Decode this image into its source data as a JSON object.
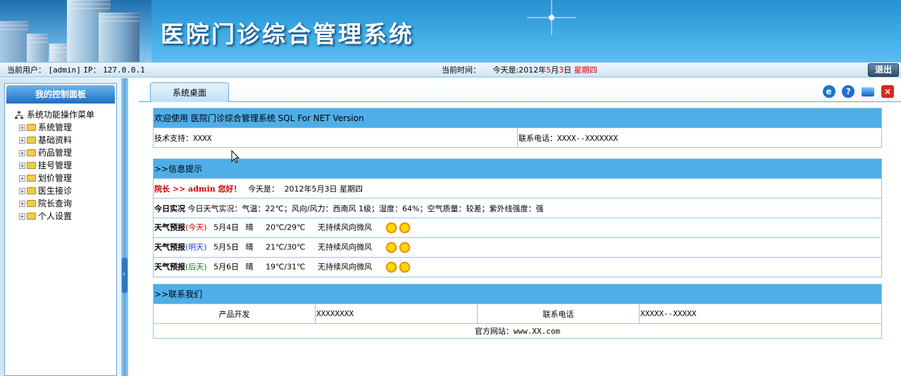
{
  "header": {
    "title": "医院门诊综合管理系统"
  },
  "status": {
    "user_label": "当前用户：",
    "user_value": "[admin]",
    "ip_label": "IP：",
    "ip_value": "127.0.0.1",
    "time_label": "当前时间：",
    "today_prefix": "今天是:2012年",
    "month": "5",
    "month_suffix": "月",
    "day": "3",
    "day_suffix": "日",
    "weekday": "星期四",
    "logout_label": "退出"
  },
  "sidebar": {
    "heading": "我的控制面板",
    "root": "系统功能操作菜单",
    "items": [
      {
        "label": "系统管理"
      },
      {
        "label": "基础资料"
      },
      {
        "label": "药品管理"
      },
      {
        "label": "挂号管理"
      },
      {
        "label": "划价管理"
      },
      {
        "label": "医生接诊"
      },
      {
        "label": "院长查询"
      },
      {
        "label": "个人设置"
      }
    ]
  },
  "tabs": {
    "active": "系统桌面"
  },
  "welcome_box": {
    "title": "欢迎使用 医院门诊综合管理系统 SQL For NET Version",
    "support_label": "技术支持：",
    "support_value": "XXXX",
    "phone_label": "联系电话：",
    "phone_value": "XXXX--XXXXXXX"
  },
  "info_box": {
    "title": ">>信息提示",
    "greeting": "院长 >> admin 您好！",
    "today_label": "今天是：",
    "today_value": "2012年5月3日 星期四",
    "realtime_label": "今日实况",
    "realtime_value": "今日天气实况：气温：22℃；风向/风力：西南风 1级；湿度：64%；空气质量：较差；紫外线强度：强",
    "forecast_label": "天气预报",
    "forecasts": [
      {
        "tag": "(今天)",
        "date": "5月4日",
        "weather": "晴",
        "temp": "20℃/29℃",
        "wind": "无持续风向微风"
      },
      {
        "tag": "(明天)",
        "date": "5月5日",
        "weather": "晴",
        "temp": "21℃/30℃",
        "wind": "无持续风向微风"
      },
      {
        "tag": "(后天)",
        "date": "5月6日",
        "weather": "晴",
        "temp": "19℃/31℃",
        "wind": "无持续风向微风"
      }
    ]
  },
  "contact_box": {
    "title": ">>联系我们",
    "dev_label": "产品开发",
    "dev_value": "XXXXXXXX",
    "phone_label": "联系电话",
    "phone_value": "XXXXX--XXXXX",
    "site": "官方网站：www.XX.com"
  },
  "colors": {
    "header_blue": "#3aa6e2",
    "table_header": "#4faee8",
    "accent_red": "#d40000"
  },
  "icons": [
    "ie-icon",
    "help-icon",
    "window-icon",
    "close-icon",
    "sun-icon",
    "folder-icon",
    "mouse-cursor-icon"
  ]
}
